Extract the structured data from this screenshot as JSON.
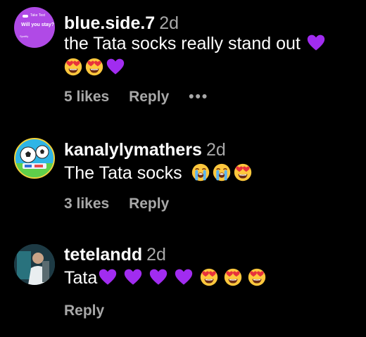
{
  "comments": [
    {
      "username": "blue.side.7",
      "time": "2d",
      "text": "the Tata socks really stand out",
      "emojis_inline": [
        "purple-heart"
      ],
      "emojis_line2": [
        "heart-eyes",
        "heart-eyes",
        "purple-heart"
      ],
      "likes": "5 likes",
      "reply": "Reply",
      "more": "•••",
      "avatar_text": {
        "line1": "Take Test",
        "line2": "Will you stay?",
        "line3": "Spotify"
      }
    },
    {
      "username": "kanalylymathers",
      "time": "2d",
      "text": "The Tata socks",
      "emojis": [
        "crying",
        "crying",
        "heart-eyes"
      ],
      "likes": "3 likes",
      "reply": "Reply"
    },
    {
      "username": "tetelandd",
      "time": "2d",
      "text": "Tata",
      "emojis": [
        "purple-heart",
        "purple-heart",
        "purple-heart",
        "purple-heart",
        "heart-eyes",
        "heart-eyes",
        "heart-eyes"
      ],
      "reply": "Reply"
    }
  ],
  "colors": {
    "background": "#000000",
    "text": "#ffffff",
    "secondary": "#a8a8a8",
    "purple_heart": "#a12cf0",
    "emoji_yellow": "#ffc83d",
    "emoji_red": "#e8323c"
  }
}
